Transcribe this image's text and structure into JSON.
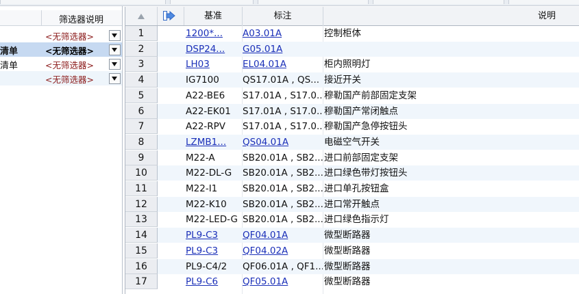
{
  "left_panel": {
    "header": "筛选器说明",
    "rows": [
      {
        "name": "",
        "filter": "<无筛选器>",
        "selected": false
      },
      {
        "name": "清单",
        "filter": "<无筛选器>",
        "selected": true
      },
      {
        "name": "清单",
        "filter": "<无筛选器>",
        "selected": false
      },
      {
        "name": "",
        "filter": "<无筛选器>",
        "selected": false
      }
    ]
  },
  "grid": {
    "headers": {
      "col1": "基准",
      "col2": "标注",
      "col3": "说明"
    },
    "rows": [
      {
        "n": "1",
        "base": "1200*...",
        "tag": "A03.01A",
        "desc": "控制柜体",
        "link": true
      },
      {
        "n": "2",
        "base": "DSP24...",
        "tag": "G05.01A",
        "desc": "",
        "link": true
      },
      {
        "n": "3",
        "base": "LH03",
        "tag": "EL04.01A",
        "desc": "柜内照明灯",
        "link": true
      },
      {
        "n": "4",
        "base": "IG7100",
        "tag": "QS17.01A , QS...",
        "desc": "接近开关",
        "link": false
      },
      {
        "n": "5",
        "base": "A22-BE6",
        "tag": "S17.01A , S17.0...",
        "desc": "穆勒国产前部固定支架",
        "link": false
      },
      {
        "n": "6",
        "base": "A22-EK01",
        "tag": "S17.01A , S17.0...",
        "desc": "穆勒国产常闭触点",
        "link": false
      },
      {
        "n": "7",
        "base": "A22-RPV",
        "tag": "S17.01A , S17.0...",
        "desc": "穆勒国产急停按钮头",
        "link": false
      },
      {
        "n": "8",
        "base": "LZMB1...",
        "tag": "QS04.01A",
        "desc": "电磁空气开关",
        "link": true
      },
      {
        "n": "9",
        "base": "M22-A",
        "tag": "SB20.01A , SB2...",
        "desc": "进口前部固定支架",
        "link": false
      },
      {
        "n": "10",
        "base": "M22-DL-G",
        "tag": "SB20.01A , SB2...",
        "desc": "进口绿色带灯按钮头",
        "link": false
      },
      {
        "n": "11",
        "base": "M22-I1",
        "tag": "SB20.01A , SB2...",
        "desc": "进口单孔按钮盒",
        "link": false
      },
      {
        "n": "12",
        "base": "M22-K10",
        "tag": "SB20.01A , SB2...",
        "desc": "进口常开触点",
        "link": false
      },
      {
        "n": "13",
        "base": "M22-LED-G",
        "tag": "SB20.01A , SB2...",
        "desc": "进口绿色指示灯",
        "link": false
      },
      {
        "n": "14",
        "base": "PL9-C3",
        "tag": "QF04.01A",
        "desc": "微型断路器",
        "link": true
      },
      {
        "n": "15",
        "base": "PL9-C3",
        "tag": "QF04.02A",
        "desc": "微型断路器",
        "link": true
      },
      {
        "n": "16",
        "base": "PL9-C4/2",
        "tag": "QF06.01A , QF1...",
        "desc": "微型断路器",
        "link": false
      },
      {
        "n": "17",
        "base": "PL9-C6",
        "tag": "QF05.01A",
        "desc": "微型断路器",
        "link": true
      }
    ]
  },
  "colors": {
    "link": "#1a2fb8",
    "filter_text": "#8b1a1a",
    "selection": "#c6d9f1"
  }
}
